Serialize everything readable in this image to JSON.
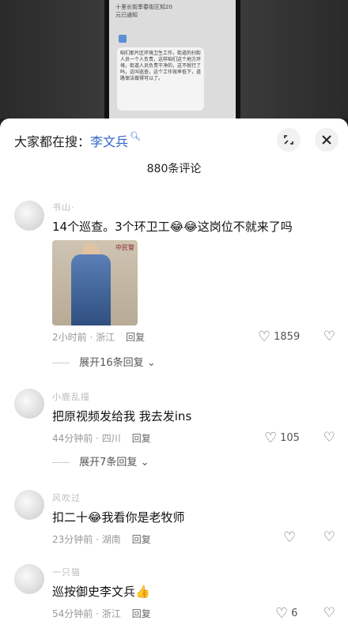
{
  "video": {
    "caption_line1": "十里长街季春街区知20",
    "caption_line2": "元已通知",
    "bubble_text": "咱们那片区环境卫生工作，街道的扫街人员一个人负责，这样咱们这个地方环境，街道人员负责干净的，这不就行了吗，这叫巡查，这个工作效率低下，道路保洁做得可以了。"
  },
  "header": {
    "search_prefix": "大家都在搜：",
    "search_keyword": "李文兵",
    "count_text": "880条评论"
  },
  "icons": {
    "collapse": "collapse-icon",
    "close": "close-icon"
  },
  "comments": [
    {
      "username": "书山·",
      "text_before": "14个巡查。3个环卫工",
      "text_after": "这岗位不就来了吗",
      "photo_sign": "中民警",
      "time": "2小时前",
      "location": "浙江",
      "reply": "回复",
      "likes": "1859",
      "expand": "展开16条回复"
    },
    {
      "username": "小鹿乱撞",
      "text": "把原视频发给我 我去发ins",
      "time": "44分钟前",
      "location": "四川",
      "reply": "回复",
      "likes": "105",
      "expand": "展开7条回复"
    },
    {
      "username": "风吹过",
      "text_before": "扣二十",
      "text_after": "我看你是老牧师",
      "time": "23分钟前",
      "location": "湖南",
      "reply": "回复",
      "likes": ""
    },
    {
      "username": "一只猫",
      "text": "巡按御史李文兵",
      "time": "54分钟前",
      "location": "浙江",
      "reply": "回复",
      "likes": "6"
    }
  ]
}
